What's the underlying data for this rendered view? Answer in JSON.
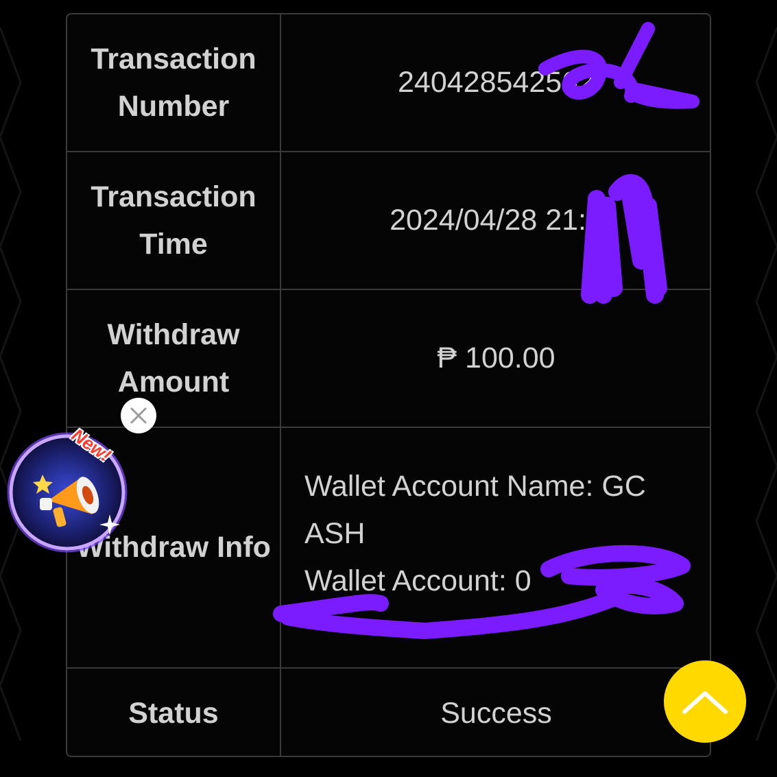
{
  "rows": {
    "transaction_number": {
      "label": "Transaction Number",
      "value": "240428542562"
    },
    "transaction_time": {
      "label": "Transaction Time",
      "value": "2024/04/28 21:1"
    },
    "withdraw_amount": {
      "label": "Withdraw Amount",
      "value": "₱ 100.00"
    },
    "withdraw_info": {
      "label": "Withdraw Info",
      "line1": "Wallet Account Name: GC",
      "line2": "ASH",
      "line3": "Wallet Account: 0"
    },
    "status": {
      "label": "Status",
      "value": "Success"
    }
  },
  "promo": {
    "badge": "New!"
  },
  "colors": {
    "scribble": "#7a1cff",
    "scroll_button": "#ffd900",
    "text": "#d2d2d2",
    "border": "#3a3a3a"
  },
  "icons": {
    "promo": "megaphone-icon",
    "close": "close-icon",
    "scroll_top": "chevron-up-icon"
  }
}
